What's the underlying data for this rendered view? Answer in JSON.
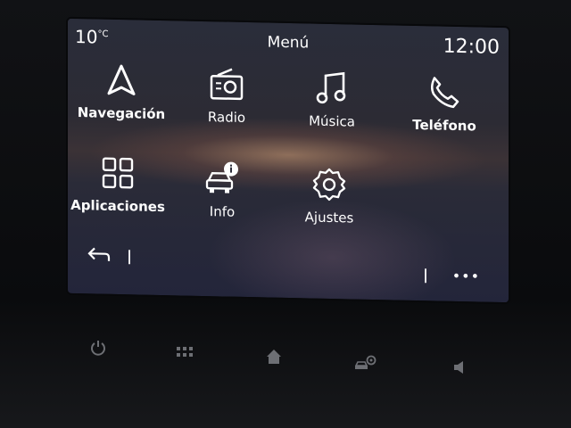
{
  "status_bar": {
    "temperature": "10",
    "temperature_unit": "°C",
    "title": "Menú",
    "time": "12:00"
  },
  "menu": {
    "items": [
      {
        "label": "Navegación",
        "icon": "navigation-arrow-icon"
      },
      {
        "label": "Radio",
        "icon": "radio-icon"
      },
      {
        "label": "Música",
        "icon": "music-note-icon"
      },
      {
        "label": "Teléfono",
        "icon": "phone-icon"
      },
      {
        "label": "Aplicaciones",
        "icon": "apps-grid-icon"
      },
      {
        "label": "Info",
        "icon": "car-info-icon"
      },
      {
        "label": "Ajustes",
        "icon": "gear-icon"
      }
    ]
  },
  "bottom_bar": {
    "back_icon": "back-arrow-icon",
    "more_icon": "more-dots-icon",
    "more_label": "•••"
  },
  "hardware_buttons": [
    "power-icon",
    "grid-icon",
    "home-icon",
    "car-settings-icon",
    "volume-icon"
  ],
  "colors": {
    "text": "#ffffff",
    "hardware_icons": "#6d6f74"
  }
}
